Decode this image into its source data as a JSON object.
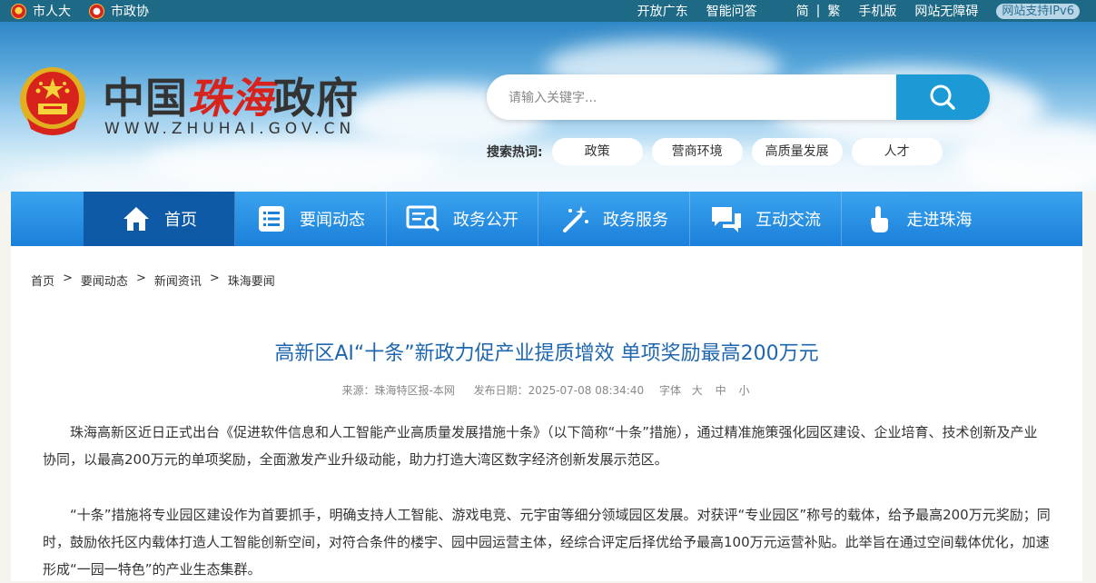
{
  "topbar": {
    "left_links": [
      "市人大",
      "市政协"
    ],
    "right_links": [
      "开放广东",
      "智能问答",
      "简",
      "|",
      "繁",
      "手机版",
      "网站无障碍"
    ],
    "ipv6_badge": "网站支持IPv6"
  },
  "header": {
    "logo_cn_part1": "中国",
    "logo_cn_part2": "珠海",
    "logo_cn_part3": "政府",
    "logo_en": "WWW.ZHUHAI.GOV.CN",
    "search_placeholder": "请输入关键字...",
    "hot_label": "搜索热词:",
    "hot_tags": [
      "政策",
      "营商环境",
      "高质量发展",
      "人才"
    ]
  },
  "nav": {
    "items": [
      {
        "label": "首页",
        "icon": "home-icon"
      },
      {
        "label": "要闻动态",
        "icon": "list-icon"
      },
      {
        "label": "政务公开",
        "icon": "document-search-icon"
      },
      {
        "label": "政务服务",
        "icon": "magic-wand-icon"
      },
      {
        "label": "互动交流",
        "icon": "chat-bubbles-icon"
      },
      {
        "label": "走进珠海",
        "icon": "touch-hand-icon"
      }
    ]
  },
  "breadcrumb": [
    "首页",
    ">",
    "要闻动态",
    ">",
    "新闻资讯",
    ">",
    "珠海要闻"
  ],
  "article": {
    "title": "高新区AI“十条”新政力促产业提质增效 单项奖励最高200万元",
    "source": "来源：珠海特区报-本网",
    "date": "发布日期：2025-07-08 08:34:40",
    "font_label": "字体",
    "font_sizes": [
      "大",
      "中",
      "小"
    ],
    "paragraphs": [
      "珠海高新区近日正式出台《促进软件信息和人工智能产业高质量发展措施十条》（以下简称“十条”措施），通过精准施策强化园区建设、企业培育、技术创新及产业协同，以最高200万元的单项奖励，全面激发产业升级动能，助力打造大湾区数字经济创新发展示范区。",
      "“十条”措施将专业园区建设作为首要抓手，明确支持人工智能、游戏电竞、元宇宙等细分领域园区发展。对获评“专业园区”称号的载体，给予最高200万元奖励；同时，鼓励依托区内载体打造人工智能创新空间，对符合条件的楼宇、园中园运营主体，经综合评定后择优给予最高100万元运营补贴。此举旨在通过空间载体优化，加速形成“一园一特色”的产业生态集群。"
    ]
  }
}
